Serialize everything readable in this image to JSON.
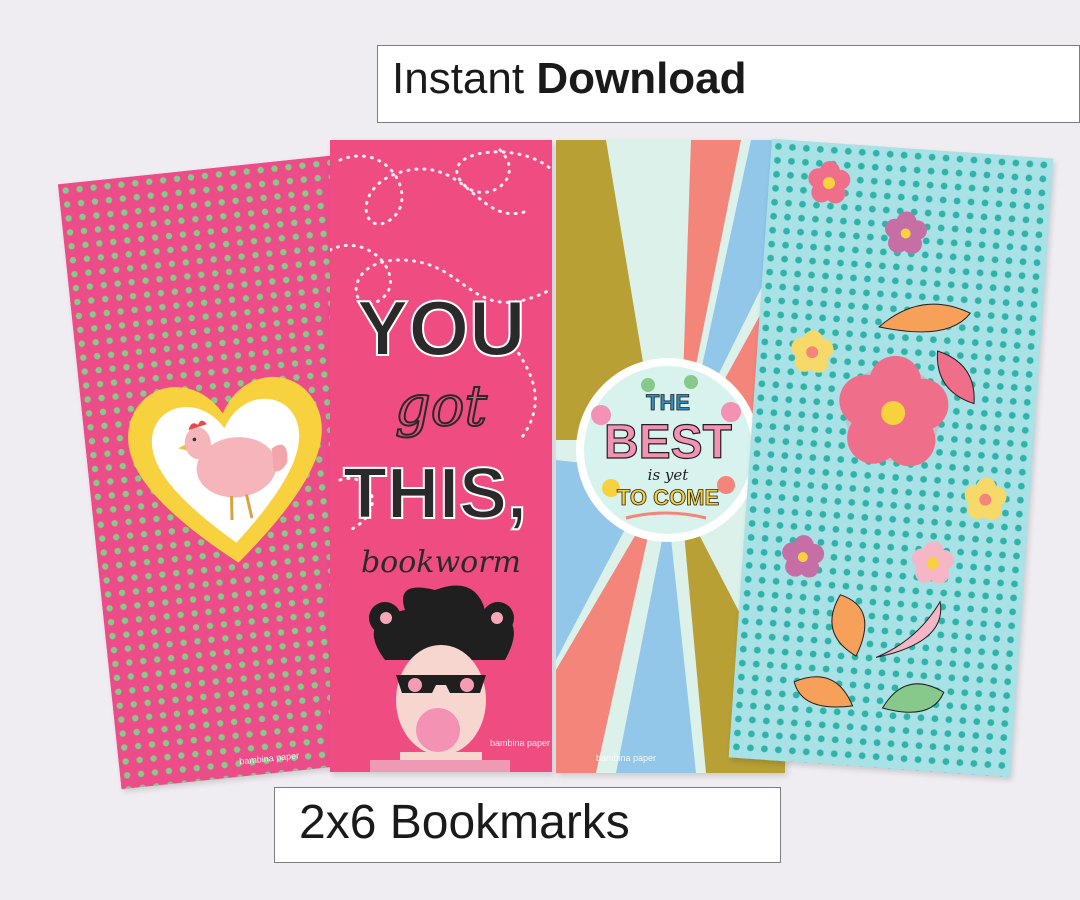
{
  "banner_top": {
    "regular": "Instant",
    "bold": "Download"
  },
  "banner_bottom": {
    "text": "2x6 Bookmarks"
  },
  "bookmarks": [
    {
      "id": "chicken",
      "brand": "bambina paper"
    },
    {
      "id": "you-got-this",
      "line1": "YOU",
      "line2": "got",
      "line3": "THIS,",
      "line4": "bookworm",
      "brand": "bambina paper"
    },
    {
      "id": "best-is-yet",
      "line1": "THE",
      "line2": "BEST",
      "line3": "is yet",
      "line4": "TO COME",
      "brand": "bambina paper"
    },
    {
      "id": "flowers-moths"
    }
  ],
  "colors": {
    "background": "#efedf1",
    "pink": "#ec4d88",
    "green_dot": "#86c98a",
    "yellow": "#f7d13e",
    "teal_dot": "#2fb3a8",
    "olive": "#b8a035",
    "sky": "#92c7ea",
    "salmon": "#f3857a"
  }
}
